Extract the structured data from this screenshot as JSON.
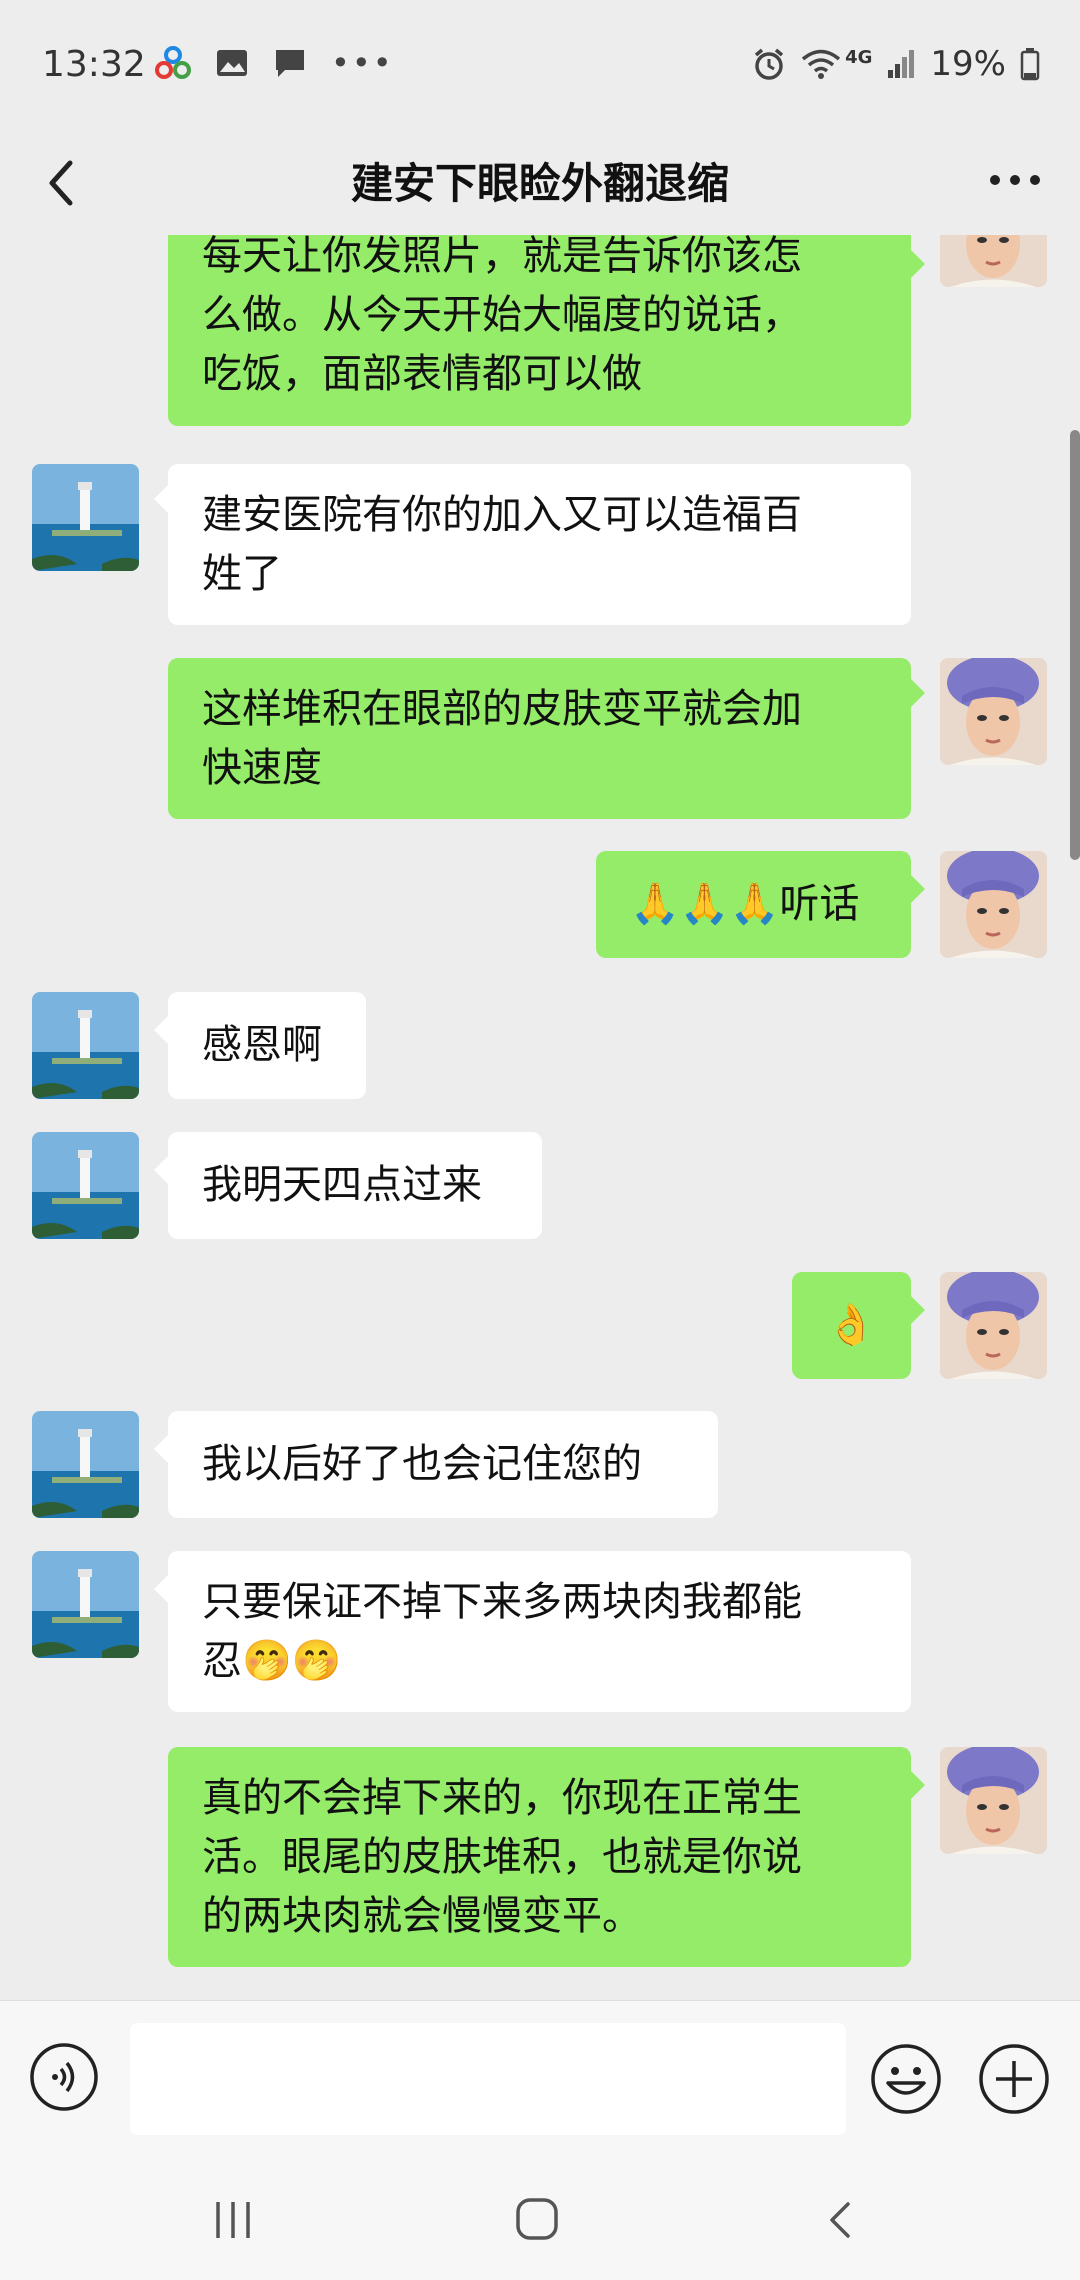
{
  "status_bar": {
    "time": "13:32",
    "battery": "19%",
    "network": "4G"
  },
  "header": {
    "title": "建安下眼睑外翻退缩"
  },
  "messages": [
    {
      "side": "right",
      "text": "每天让你发照片，就是告诉你该怎\n么做。从今天开始大幅度的说话，\n吃饭，面部表情都可以做"
    },
    {
      "side": "left",
      "text": "建安医院有你的加入又可以造福百\n姓了"
    },
    {
      "side": "right",
      "text": "这样堆积在眼部的皮肤变平就会加\n快速度"
    },
    {
      "side": "right",
      "text": "🙏🙏🙏听话"
    },
    {
      "side": "left",
      "text": "感恩啊"
    },
    {
      "side": "left",
      "text": "我明天四点过来"
    },
    {
      "side": "right",
      "text": "👌"
    },
    {
      "side": "left",
      "text": "我以后好了也会记住您的"
    },
    {
      "side": "left",
      "text": "只要保证不掉下来多两块肉我都能\n忍🤭🤭"
    },
    {
      "side": "right",
      "text": "真的不会掉下来的，你现在正常生\n活。眼尾的皮肤堆积，也就是你说\n的两块肉就会慢慢变平。"
    }
  ],
  "input": {
    "value": "",
    "placeholder": ""
  },
  "icons": {
    "back": "chevron-left-icon",
    "more": "more-dots-icon",
    "voice": "voice-icon",
    "emoji": "emoji-icon",
    "plus": "plus-icon"
  },
  "colors": {
    "bubble_self": "#95ec69",
    "bubble_other": "#ffffff",
    "background": "#ededed"
  }
}
